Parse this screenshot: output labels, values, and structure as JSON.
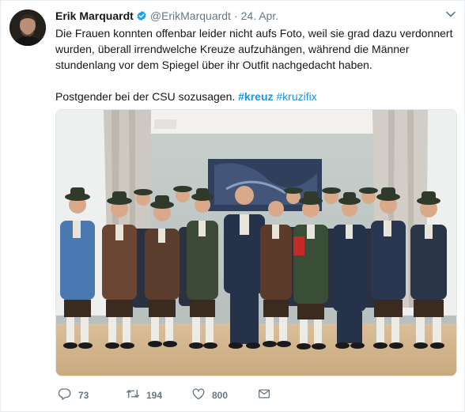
{
  "tweet": {
    "author_name": "Erik Marquardt",
    "handle": "@ErikMarquardt",
    "separator": "·",
    "date": "24. Apr.",
    "text_line_1": "Die Frauen konnten offenbar leider nicht aufs Foto, weil sie grad dazu verdonnert",
    "text_line_2": "wurden, überall irrendwelche Kreuze aufzuhängen, während die Männer",
    "text_line_3": "stundenlang vor dem Spiegel über ihr Outfit nachgedacht haben.",
    "text_line_4": "Postgender bei der CSU sozusagen.",
    "hashtag_1": "#kreuz",
    "hashtag_2": "#kruzifix"
  },
  "actions": {
    "reply_count": "73",
    "retweet_count": "194",
    "like_count": "800"
  },
  "colors": {
    "link": "#1b95e0",
    "secondary_text": "#657786",
    "verified": "#1da1f2"
  },
  "icons": [
    "verified-badge-icon",
    "chevron-down-icon",
    "reply-icon",
    "retweet-icon",
    "like-icon",
    "direct-message-icon"
  ]
}
